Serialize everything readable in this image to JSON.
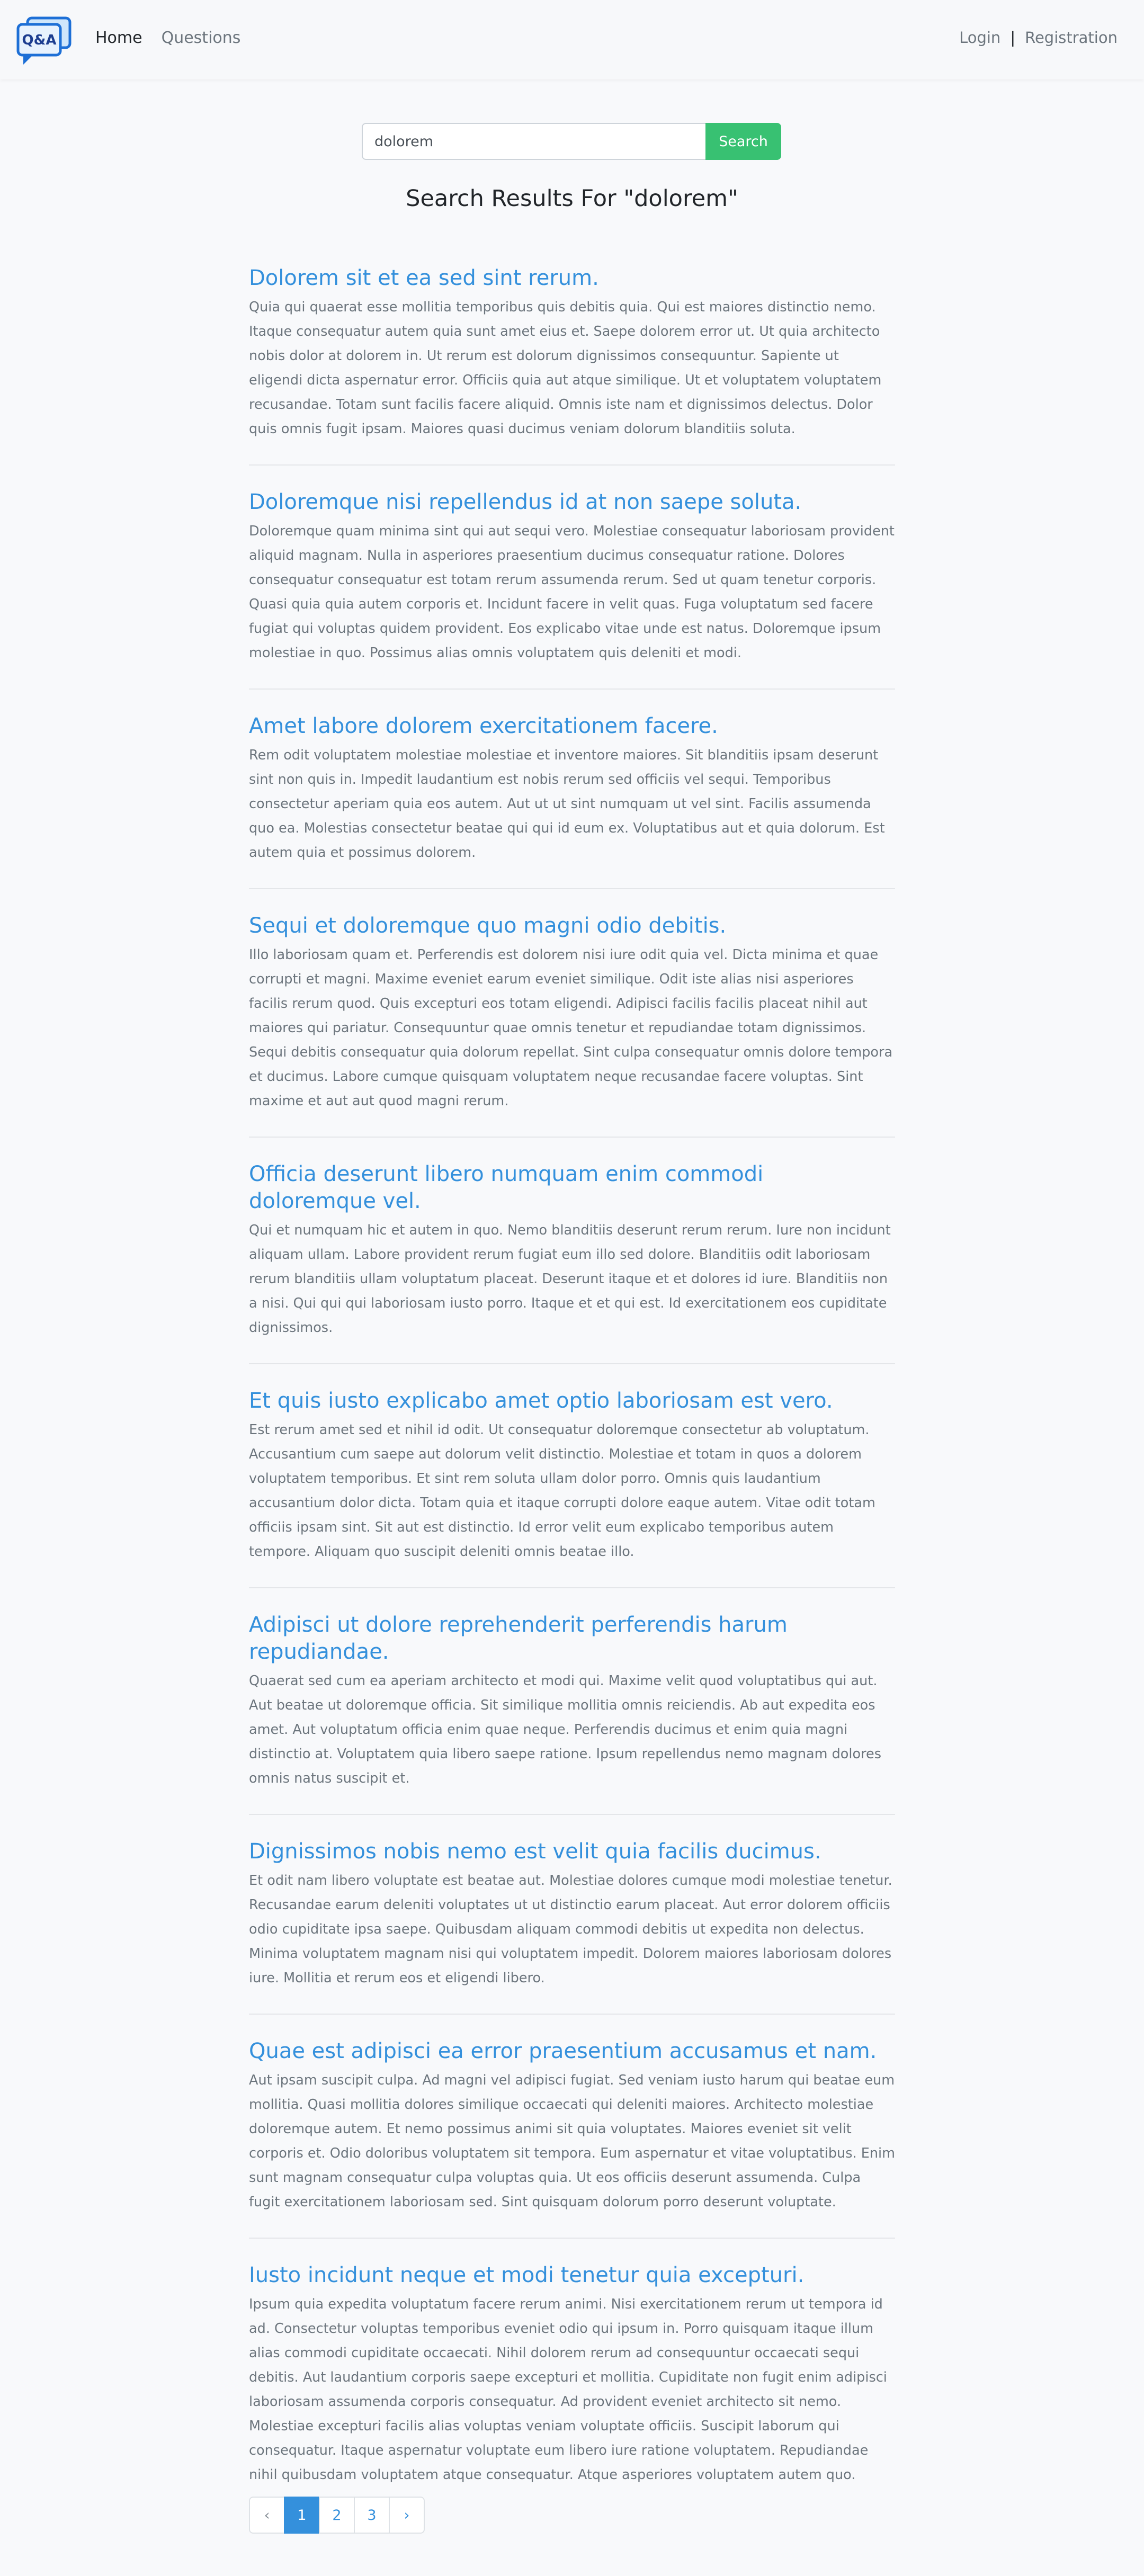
{
  "nav": {
    "logo_text": "Q&A",
    "home": "Home",
    "questions": "Questions",
    "login": "Login",
    "separator": "|",
    "registration": "Registration"
  },
  "search": {
    "value": "dolorem",
    "button": "Search"
  },
  "heading": "Search Results For \"dolorem\"",
  "results": [
    {
      "title": "Dolorem sit et ea sed sint rerum.",
      "body": "Quia qui quaerat esse mollitia temporibus quis debitis quia. Qui est maiores distinctio nemo. Itaque consequatur autem quia sunt amet eius et. Saepe dolorem error ut. Ut quia architecto nobis dolor at dolorem in. Ut rerum est dolorum dignissimos consequuntur. Sapiente ut eligendi dicta aspernatur error. Officiis quia aut atque similique. Ut et voluptatem voluptatem recusandae. Totam sunt facilis facere aliquid. Omnis iste nam et dignissimos delectus. Dolor quis omnis fugit ipsam. Maiores quasi ducimus veniam dolorum blanditiis soluta."
    },
    {
      "title": "Doloremque nisi repellendus id at non saepe soluta.",
      "body": "Doloremque quam minima sint qui aut sequi vero. Molestiae consequatur laboriosam provident aliquid magnam. Nulla in asperiores praesentium ducimus consequatur ratione. Dolores consequatur consequatur est totam rerum assumenda rerum. Sed ut quam tenetur corporis. Quasi quia quia autem corporis et. Incidunt facere in velit quas. Fuga voluptatum sed facere fugiat qui voluptas quidem provident. Eos explicabo vitae unde est natus. Doloremque ipsum molestiae in quo. Possimus alias omnis voluptatem quis deleniti et modi."
    },
    {
      "title": "Amet labore dolorem exercitationem facere.",
      "body": "Rem odit voluptatem molestiae molestiae et inventore maiores. Sit blanditiis ipsam deserunt sint non quis in. Impedit laudantium est nobis rerum sed officiis vel sequi. Temporibus consectetur aperiam quia eos autem. Aut ut ut sint numquam ut vel sint. Facilis assumenda quo ea. Molestias consectetur beatae qui qui id eum ex. Voluptatibus aut et quia dolorum. Est autem quia et possimus dolorem."
    },
    {
      "title": "Sequi et doloremque quo magni odio debitis.",
      "body": "Illo laboriosam quam et. Perferendis est dolorem nisi iure odit quia vel. Dicta minima et quae corrupti et magni. Maxime eveniet earum eveniet similique. Odit iste alias nisi asperiores facilis rerum quod. Quis excepturi eos totam eligendi. Adipisci facilis facilis placeat nihil aut maiores qui pariatur. Consequuntur quae omnis tenetur et repudiandae totam dignissimos. Sequi debitis consequatur quia dolorum repellat. Sint culpa consequatur omnis dolore tempora et ducimus. Labore cumque quisquam voluptatem neque recusandae facere voluptas. Sint maxime et aut aut quod magni rerum."
    },
    {
      "title": "Officia deserunt libero numquam enim commodi doloremque vel.",
      "body": "Qui et numquam hic et autem in quo. Nemo blanditiis deserunt rerum rerum. Iure non incidunt aliquam ullam. Labore provident rerum fugiat eum illo sed dolore. Blanditiis odit laboriosam rerum blanditiis ullam voluptatum placeat. Deserunt itaque et et dolores id iure. Blanditiis non a nisi. Qui qui qui laboriosam iusto porro. Itaque et et qui est. Id exercitationem eos cupiditate dignissimos."
    },
    {
      "title": "Et quis iusto explicabo amet optio laboriosam est vero.",
      "body": "Est rerum amet sed et nihil id odit. Ut consequatur doloremque consectetur ab voluptatum. Accusantium cum saepe aut dolorum velit distinctio. Molestiae et totam in quos a dolorem voluptatem temporibus. Et sint rem soluta ullam dolor porro. Omnis quis laudantium accusantium dolor dicta. Totam quia et itaque corrupti dolore eaque autem. Vitae odit totam officiis ipsam sint. Sit aut est distinctio. Id error velit eum explicabo temporibus autem tempore. Aliquam quo suscipit deleniti omnis beatae illo."
    },
    {
      "title": "Adipisci ut dolore reprehenderit perferendis harum repudiandae.",
      "body": "Quaerat sed cum ea aperiam architecto et modi qui. Maxime velit quod voluptatibus qui aut. Aut beatae ut doloremque officia. Sit similique mollitia omnis reiciendis. Ab aut expedita eos amet. Aut voluptatum officia enim quae neque. Perferendis ducimus et enim quia magni distinctio at. Voluptatem quia libero saepe ratione. Ipsum repellendus nemo magnam dolores omnis natus suscipit et."
    },
    {
      "title": "Dignissimos nobis nemo est velit quia facilis ducimus.",
      "body": "Et odit nam libero voluptate est beatae aut. Molestiae dolores cumque modi molestiae tenetur. Recusandae earum deleniti voluptates ut ut distinctio earum placeat. Aut error dolorem officiis odio cupiditate ipsa saepe. Quibusdam aliquam commodi debitis ut expedita non delectus. Minima voluptatem magnam nisi qui voluptatem impedit. Dolorem maiores laboriosam dolores iure. Mollitia et rerum eos et eligendi libero."
    },
    {
      "title": "Quae est adipisci ea error praesentium accusamus et nam.",
      "body": "Aut ipsam suscipit culpa. Ad magni vel adipisci fugiat. Sed veniam iusto harum qui beatae eum mollitia. Quasi mollitia dolores similique occaecati qui deleniti maiores. Architecto molestiae doloremque autem. Et nemo possimus animi sit quia voluptates. Maiores eveniet sit velit corporis et. Odio doloribus voluptatem sit tempora. Eum aspernatur et vitae voluptatibus. Enim sunt magnam consequatur culpa voluptas quia. Ut eos officiis deserunt assumenda. Culpa fugit exercitationem laboriosam sed. Sint quisquam dolorum porro deserunt voluptate."
    },
    {
      "title": "Iusto incidunt neque et modi tenetur quia excepturi.",
      "body": "Ipsum quia expedita voluptatum facere rerum animi. Nisi exercitationem rerum ut tempora id ad. Consectetur voluptas temporibus eveniet odio qui ipsum in. Porro quisquam itaque illum alias commodi cupiditate occaecati. Nihil dolorem rerum ad consequuntur occaecati sequi debitis. Aut laudantium corporis saepe excepturi et mollitia. Cupiditate non fugit enim adipisci laboriosam assumenda corporis consequatur. Ad provident eveniet architecto sit nemo. Molestiae excepturi facilis alias voluptas veniam voluptate officiis. Suscipit laborum qui consequatur. Itaque aspernatur voluptate eum libero iure ratione voluptatem. Repudiandae nihil quibusdam voluptatem atque consequatur. Atque asperiores voluptatem autem quo."
    }
  ],
  "pagination": {
    "prev": "‹",
    "pages": [
      "1",
      "2",
      "3"
    ],
    "current": "1",
    "next": "›"
  },
  "colors": {
    "accent": "#3490dc",
    "search_button": "#38c172",
    "body_text": "#6c757d"
  }
}
